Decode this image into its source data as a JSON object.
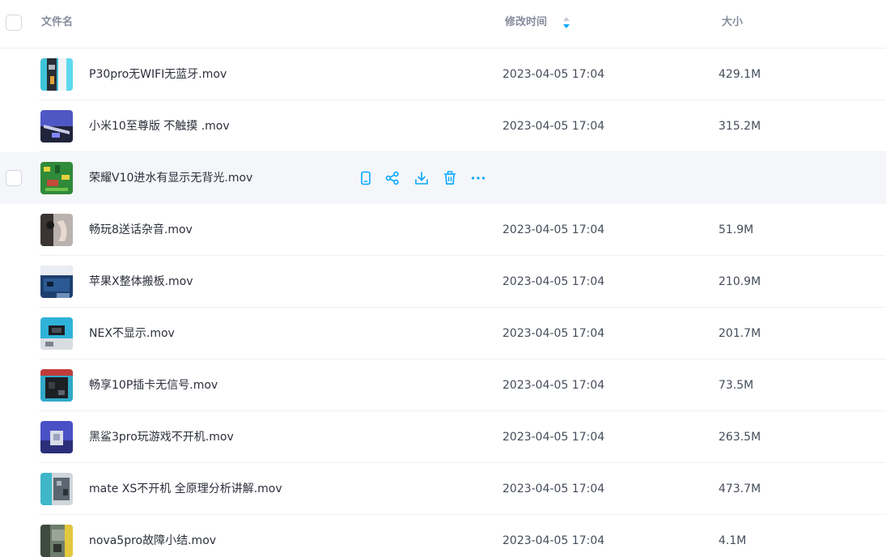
{
  "header": {
    "name_label": "文件名",
    "time_label": "修改时间",
    "size_label": "大小"
  },
  "colors": {
    "accent": "#06a7ff",
    "hover_bg": "#f5f6fa",
    "divider": "#f0f0f2"
  },
  "actions": [
    "phone-icon",
    "share-icon",
    "download-icon",
    "delete-icon",
    "more-icon"
  ],
  "files": [
    {
      "name": "P30pro无WIFI无蓝牙.mov",
      "time": "2023-04-05 17:04",
      "size": "429.1M",
      "hovered": false
    },
    {
      "name": "小米10至尊版 不触摸 .mov",
      "time": "2023-04-05 17:04",
      "size": "315.2M",
      "hovered": false
    },
    {
      "name": "荣耀V10进水有显示无背光.mov",
      "time": "",
      "size": "",
      "hovered": true
    },
    {
      "name": "畅玩8送话杂音.mov",
      "time": "2023-04-05 17:04",
      "size": "51.9M",
      "hovered": false
    },
    {
      "name": "苹果X整体搬板.mov",
      "time": "2023-04-05 17:04",
      "size": "210.9M",
      "hovered": false
    },
    {
      "name": "NEX不显示.mov",
      "time": "2023-04-05 17:04",
      "size": "201.7M",
      "hovered": false
    },
    {
      "name": "畅享10P插卡无信号.mov",
      "time": "2023-04-05 17:04",
      "size": "73.5M",
      "hovered": false
    },
    {
      "name": "黑鲨3pro玩游戏不开机.mov",
      "time": "2023-04-05 17:04",
      "size": "263.5M",
      "hovered": false
    },
    {
      "name": "mate XS不开机 全原理分析讲解.mov",
      "time": "2023-04-05 17:04",
      "size": "473.7M",
      "hovered": false
    },
    {
      "name": "nova5pro故障小结.mov",
      "time": "2023-04-05 17:04",
      "size": "4.1M",
      "hovered": false
    }
  ]
}
